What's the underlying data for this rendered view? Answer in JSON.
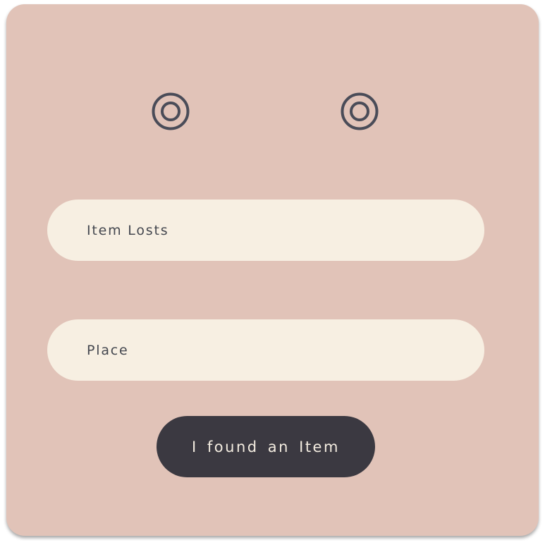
{
  "icons": {
    "left_eye": "concentric-circle-icon",
    "right_eye": "concentric-circle-icon"
  },
  "form": {
    "item_field": {
      "placeholder": "Item Losts"
    },
    "place_field": {
      "placeholder": "Place"
    },
    "submit_label": "I found an Item"
  },
  "colors": {
    "card_background": "#e1c3b8",
    "field_background": "#f7efe2",
    "button_background": "#3b3941",
    "button_text": "#f3ece0",
    "icon_stroke": "#4a4c58",
    "text": "#44474f"
  }
}
